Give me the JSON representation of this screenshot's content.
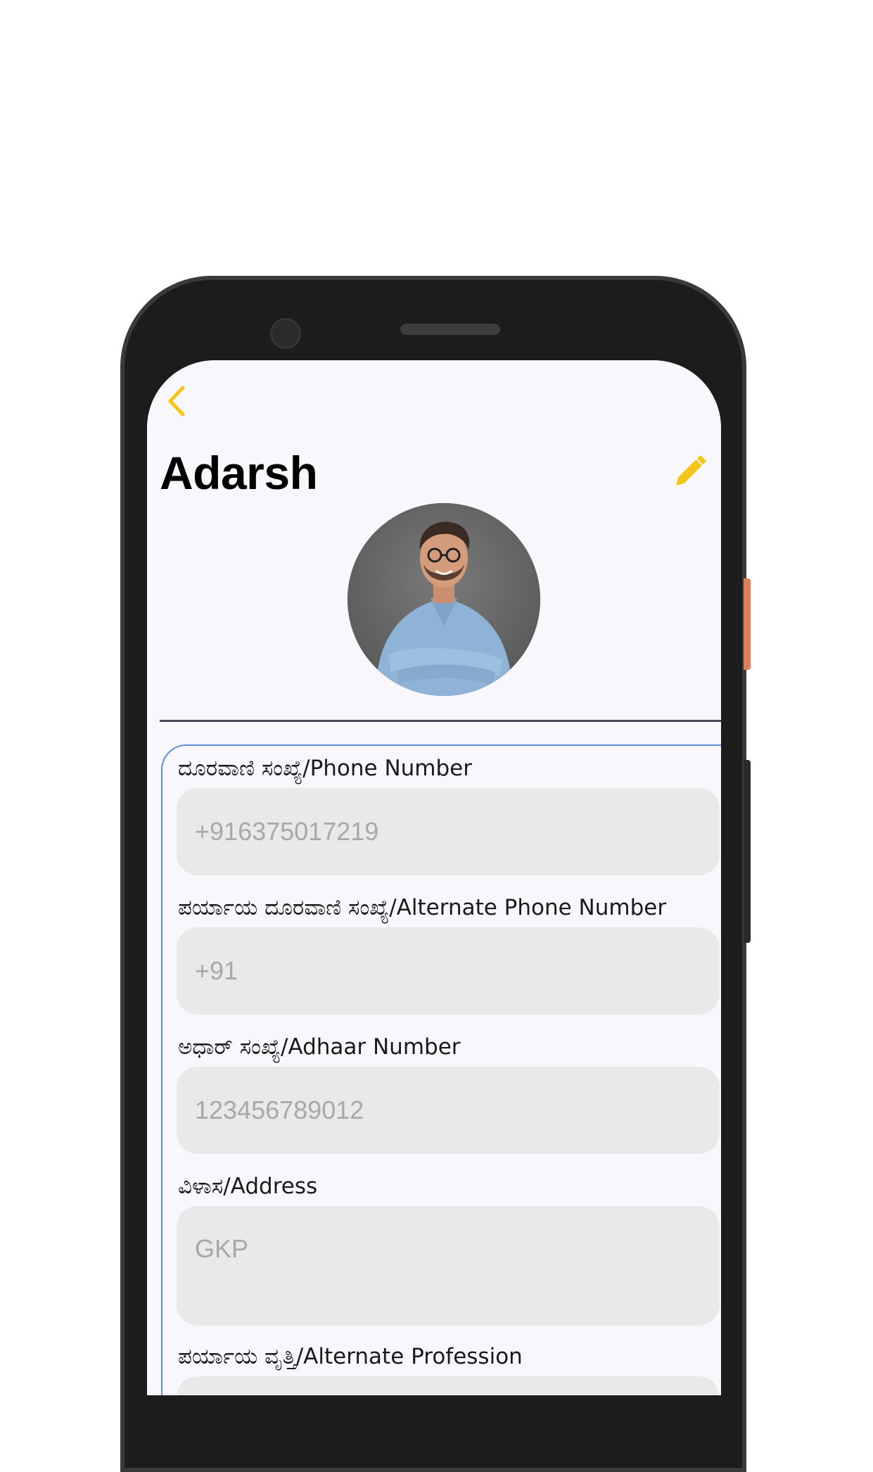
{
  "header": {
    "title": "Adarsh"
  },
  "fields": [
    {
      "label": "ದೂರವಾಣಿ ಸಂಖ್ಯೆ/Phone Number",
      "value": "+916375017219"
    },
    {
      "label": "ಪರ್ಯಾಯ ದೂರವಾಣಿ ಸಂಖ್ಯೆ/Alternate Phone Number",
      "value": "+91"
    },
    {
      "label": "ಅಧಾರ್ ಸಂಖ್ಯೆ/Adhaar Number",
      "value": "123456789012"
    },
    {
      "label": "ವಿಳಾಸ/Address",
      "value": "GKP"
    },
    {
      "label": "ಪರ್ಯಾಯ ವೃತ್ತಿ/Alternate Profession",
      "value": ""
    }
  ],
  "icons": {
    "back": "chevron-left-icon",
    "edit": "pencil-icon"
  },
  "colors": {
    "accent": "#F5C518",
    "input_background": "#E9E9E9",
    "form_border": "#5B8FE0",
    "screen_background": "#F8F8FC"
  }
}
